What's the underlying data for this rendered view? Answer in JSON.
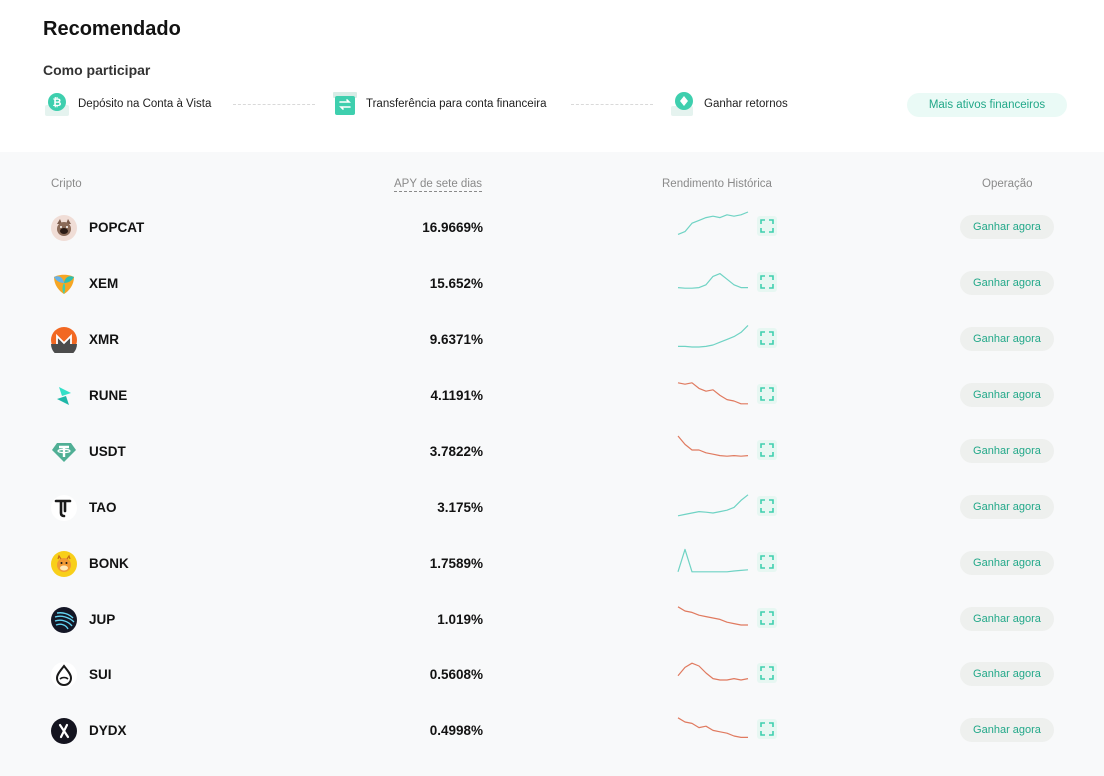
{
  "header": {
    "title": "Recomendado",
    "how_title": "Como participar",
    "steps": [
      {
        "label": "Depósito na Conta à Vista",
        "icon": "bitcoin-deposit-icon"
      },
      {
        "label": "Transferência para conta financeira",
        "icon": "transfer-icon"
      },
      {
        "label": "Ganhar retornos",
        "icon": "diamond-returns-icon"
      }
    ],
    "more_button": "Mais ativos financeiros"
  },
  "table": {
    "columns": {
      "coin": "Cripto",
      "apy": "APY de sete dias",
      "history": "Rendimento Histórica",
      "operation": "Operação"
    },
    "rows": [
      {
        "coin": "POPCAT",
        "apy": "16.9669%",
        "trend": "up",
        "series": [
          2,
          3,
          6,
          7,
          8,
          8.5,
          8,
          9,
          8.5,
          9,
          10
        ],
        "button": "Ganhar agora",
        "icon": "popcat-icon"
      },
      {
        "coin": "XEM",
        "apy": "15.652%",
        "trend": "up",
        "series": [
          3,
          2.8,
          2.8,
          3,
          4,
          7,
          8,
          6,
          4,
          3,
          3
        ],
        "button": "Ganhar agora",
        "icon": "xem-icon"
      },
      {
        "coin": "XMR",
        "apy": "9.6371%",
        "trend": "up",
        "series": [
          2,
          2,
          1.8,
          1.8,
          2,
          2.5,
          3.5,
          4.5,
          5.5,
          7,
          9.5
        ],
        "button": "Ganhar agora",
        "icon": "monero-icon"
      },
      {
        "coin": "RUNE",
        "apy": "4.1191%",
        "trend": "down",
        "series": [
          9,
          8.5,
          9,
          7,
          6,
          6.5,
          4.5,
          3,
          2.5,
          1.5,
          1.5
        ],
        "button": "Ganhar agora",
        "icon": "rune-icon"
      },
      {
        "coin": "USDT",
        "apy": "3.7822%",
        "trend": "down",
        "series": [
          10,
          7,
          5,
          5,
          4,
          3.5,
          3,
          2.8,
          3,
          2.8,
          3
        ],
        "button": "Ganhar agora",
        "icon": "tether-icon"
      },
      {
        "coin": "TAO",
        "apy": "3.175%",
        "trend": "up",
        "series": [
          1.5,
          2,
          2.5,
          3,
          2.8,
          2.5,
          3,
          3.5,
          4.5,
          7,
          9
        ],
        "button": "Ganhar agora",
        "icon": "bittensor-icon"
      },
      {
        "coin": "BONK",
        "apy": "1.7589%",
        "trend": "up",
        "series": [
          1.5,
          9.5,
          1.5,
          1.5,
          1.5,
          1.5,
          1.5,
          1.5,
          1.8,
          2,
          2.2
        ],
        "button": "Ganhar agora",
        "icon": "bonk-icon"
      },
      {
        "coin": "JUP",
        "apy": "1.019%",
        "trend": "down",
        "series": [
          9,
          7.5,
          7,
          6,
          5.5,
          5,
          4.5,
          3.5,
          3,
          2.5,
          2.5
        ],
        "button": "Ganhar agora",
        "icon": "jupiter-icon"
      },
      {
        "coin": "SUI",
        "apy": "0.5608%",
        "trend": "down",
        "series": [
          4,
          7,
          8.5,
          7.5,
          5,
          3,
          2.5,
          2.5,
          3,
          2.5,
          3
        ],
        "button": "Ganhar agora",
        "icon": "sui-icon"
      },
      {
        "coin": "DYDX",
        "apy": "0.4998%",
        "trend": "down",
        "series": [
          9,
          7.5,
          7,
          5.5,
          6,
          4.5,
          4,
          3.5,
          2.5,
          2,
          2
        ],
        "button": "Ganhar agora",
        "icon": "dydx-icon"
      }
    ]
  },
  "colors": {
    "accent": "#22a889",
    "up": "#6fd3c4",
    "down": "#e07a5f"
  }
}
